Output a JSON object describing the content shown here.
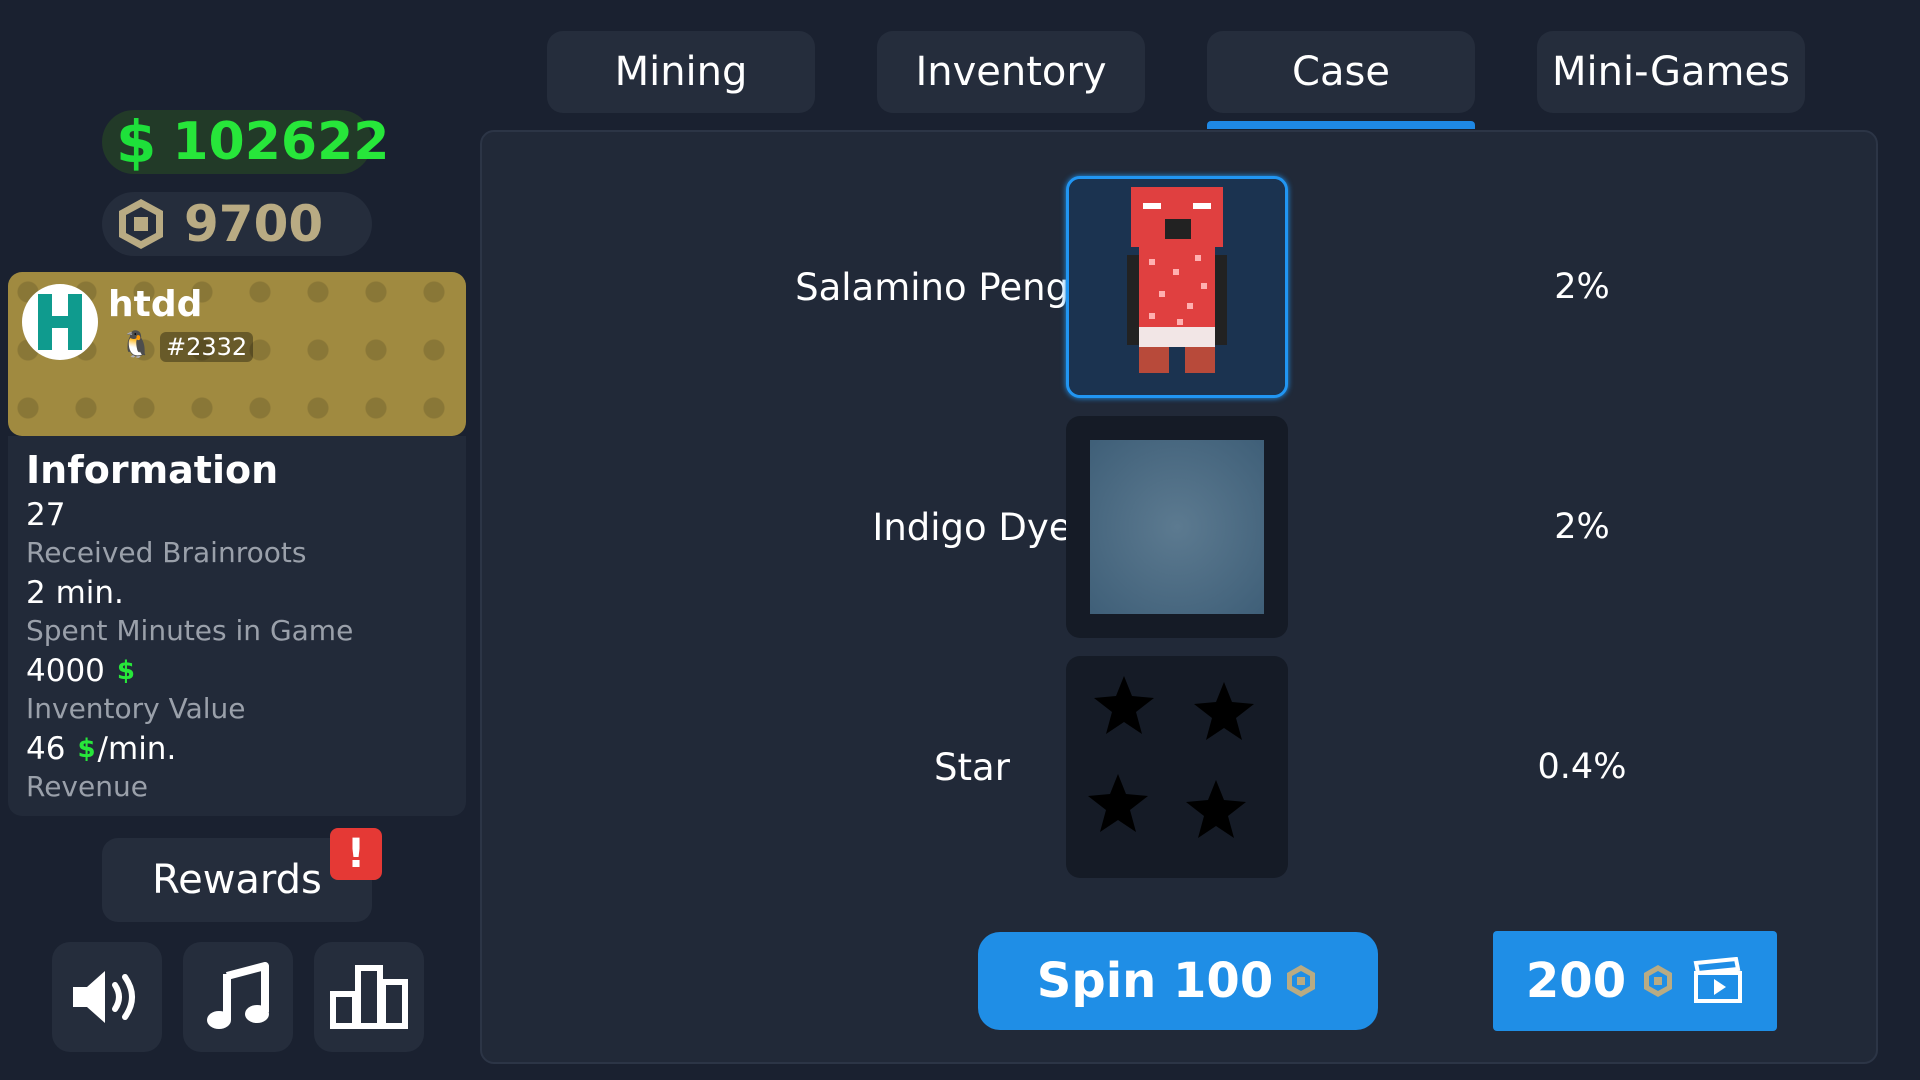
{
  "tabs": [
    {
      "label": "Mining",
      "active": false
    },
    {
      "label": "Inventory",
      "active": false
    },
    {
      "label": "Case",
      "active": true
    },
    {
      "label": "Mini-Games",
      "active": false
    }
  ],
  "currency": {
    "cash_symbol": "$",
    "cash": "102622",
    "robux": "9700",
    "cash_color": "#27e63a"
  },
  "profile": {
    "username": "htdd",
    "tag": "#2332"
  },
  "information": {
    "title": "Information",
    "stats": [
      {
        "value": "27",
        "label": "Received Brainroots"
      },
      {
        "value": "2 min.",
        "label": "Spent Minutes in Game"
      },
      {
        "value": "4000",
        "label": "Inventory Value",
        "icon": "$"
      },
      {
        "value": "46",
        "label": "Revenue",
        "icon": "$",
        "suffix": "/min."
      }
    ]
  },
  "rewards": {
    "label": "Rewards",
    "badge": "!"
  },
  "icon_buttons": [
    "speaker-icon",
    "music-note-icon",
    "leaderboard-icon"
  ],
  "case_items": [
    {
      "name": "Salamino Penguino",
      "chance": "2%",
      "selected": true
    },
    {
      "name": "Indigo Dye",
      "chance": "2%",
      "selected": false
    },
    {
      "name": "Star",
      "chance": "0.4%",
      "selected": false
    }
  ],
  "spin": {
    "label": "Spin 100",
    "alt_label": "200"
  },
  "colors": {
    "accent": "#1f8ee6",
    "background": "#1a2130",
    "panel": "#212938",
    "badge": "#e53935"
  }
}
